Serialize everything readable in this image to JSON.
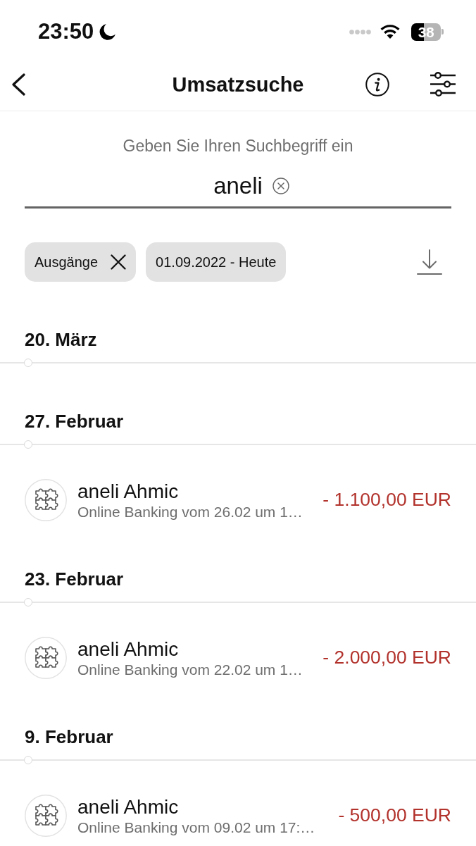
{
  "status_bar": {
    "time": "23:50",
    "battery": "38"
  },
  "header": {
    "title": "Umsatzsuche"
  },
  "search": {
    "label": "Geben Sie Ihren Suchbegriff ein",
    "value": "aneli"
  },
  "filters": [
    {
      "label": "Ausgänge",
      "removable": true
    },
    {
      "label": "01.09.2022 - Heute",
      "removable": false
    }
  ],
  "groups": [
    {
      "date": "20. März"
    },
    {
      "date": "27. Februar",
      "transactions": [
        {
          "name": "aneli Ahmic",
          "description": "Online Banking vom 26.02 um 1…",
          "amount": "- 1.100,00 EUR"
        }
      ]
    },
    {
      "date": "23. Februar",
      "transactions": [
        {
          "name": "aneli Ahmic",
          "description": "Online Banking vom 22.02 um 1…",
          "amount": "- 2.000,00 EUR"
        }
      ]
    },
    {
      "date": "9. Februar",
      "transactions": [
        {
          "name": "aneli Ahmic",
          "description": "Online Banking vom 09.02 um 17:…",
          "amount": "- 500,00 EUR"
        }
      ]
    }
  ]
}
